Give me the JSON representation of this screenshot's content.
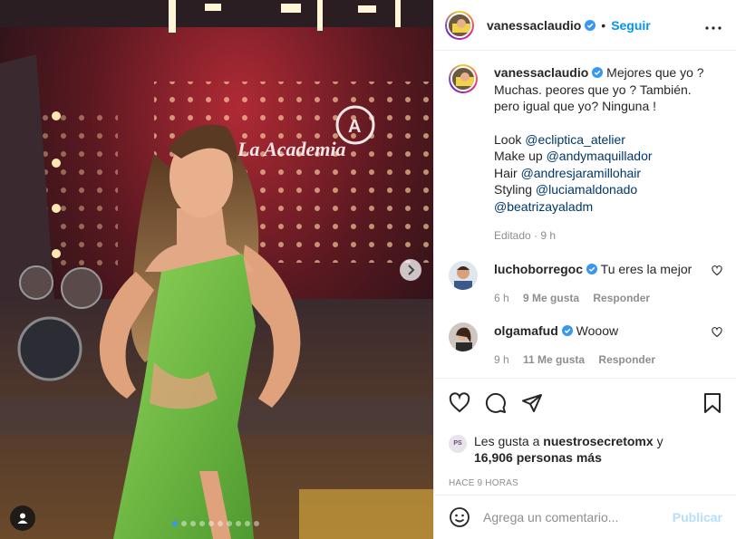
{
  "post": {
    "author": "vanessaclaudio",
    "follow_label": "Seguir",
    "separator": "•",
    "photo": {
      "sign_text": "La Academia",
      "carousel_dots": 10,
      "active_dot": 1
    }
  },
  "caption": {
    "username": "vanessaclaudio",
    "line1": "Mejores que yo ?",
    "line2": "Muchas. peores que yo ? También.",
    "line3": "pero igual que yo? Ninguna !",
    "look_label": "Look",
    "look_mention": "@ecliptica_atelier",
    "makeup_label": "Make up",
    "makeup_mention": "@andymaquillador",
    "hair_label": "Hair",
    "hair_mention": "@andresjaramillohair",
    "styling_label": "Styling",
    "styling_mention1": "@luciamaldonado",
    "styling_mention2": "@beatrizayaladm",
    "meta": "Editado · 9 h"
  },
  "comments": [
    {
      "username": "luchoborregoc",
      "text": "Tu eres la mejor",
      "time": "6 h",
      "likes": "9 Me gusta",
      "reply": "Responder"
    },
    {
      "username": "olgamafud",
      "text": "Wooow",
      "time": "9 h",
      "likes": "11 Me gusta",
      "reply": "Responder"
    }
  ],
  "likes": {
    "avatar_text": "PS",
    "prefix": "Les gusta a",
    "user": "nuestrosecretomx",
    "joiner": "y",
    "count": "16,906 personas más"
  },
  "timestamp": "HACE 9 HORAS",
  "add_comment": {
    "placeholder": "Agrega un comentario...",
    "publish_label": "Publicar"
  },
  "icons": {
    "verified": "verified-badge-icon",
    "more": "more-options-icon",
    "like": "heart-icon",
    "comment": "comment-icon",
    "share": "share-icon",
    "save": "bookmark-icon",
    "emoji": "emoji-icon",
    "next": "chevron-right-icon",
    "tag": "user-tag-icon"
  },
  "colors": {
    "accent_blue": "#0095f6",
    "verified_blue": "#3897f0",
    "mention": "#00376b",
    "muted": "#8e8e8e",
    "dress_green": "#7cc44a"
  }
}
